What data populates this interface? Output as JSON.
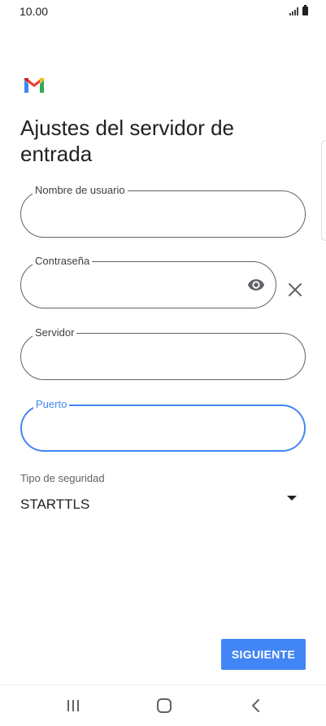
{
  "status_bar": {
    "time": "10.00"
  },
  "app": {
    "logo_icon": "gmail-icon"
  },
  "page": {
    "title": "Ajustes del servidor de entrada"
  },
  "form": {
    "username": {
      "label": "Nombre de usuario",
      "value": ""
    },
    "password": {
      "label": "Contraseña",
      "value": ""
    },
    "server": {
      "label": "Servidor",
      "value": ""
    },
    "port": {
      "label": "Puerto",
      "value": ""
    },
    "security": {
      "label": "Tipo de seguridad",
      "value": "STARTTLS"
    }
  },
  "actions": {
    "next_label": "SIGUIENTE"
  },
  "colors": {
    "accent": "#4285f4",
    "text": "#202124",
    "outline": "#5f6368"
  }
}
